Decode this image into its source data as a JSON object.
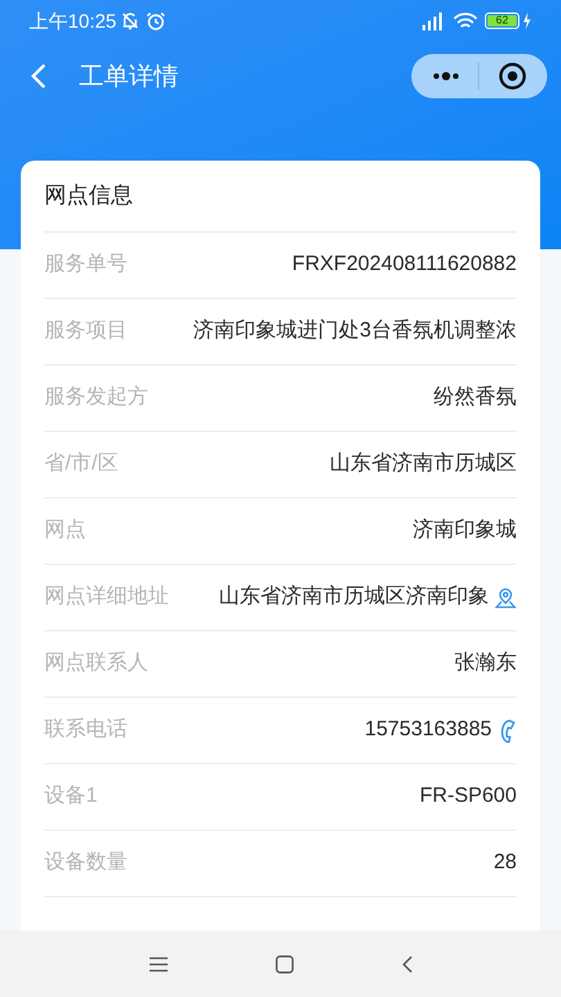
{
  "status_bar": {
    "time": "上午10:25",
    "battery": "62"
  },
  "header": {
    "title": "工单详情"
  },
  "card": {
    "title": "网点信息",
    "rows": [
      {
        "label": "服务单号",
        "value": "FRXF202408111620882"
      },
      {
        "label": "服务项目",
        "value": "济南印象城进门处3台香氛机调整浓"
      },
      {
        "label": "服务发起方",
        "value": "纷然香氛"
      },
      {
        "label": "省/市/区",
        "value": "山东省济南市历城区"
      },
      {
        "label": "网点",
        "value": "济南印象城"
      },
      {
        "label": "网点详细地址",
        "value": "山东省济南市历城区济南印象",
        "kind": "address"
      },
      {
        "label": "网点联系人",
        "value": "张瀚东"
      },
      {
        "label": "联系电话",
        "value": "15753163885",
        "kind": "phone"
      },
      {
        "label": "设备1",
        "value": "FR-SP600"
      },
      {
        "label": "设备数量",
        "value": "28"
      }
    ]
  }
}
